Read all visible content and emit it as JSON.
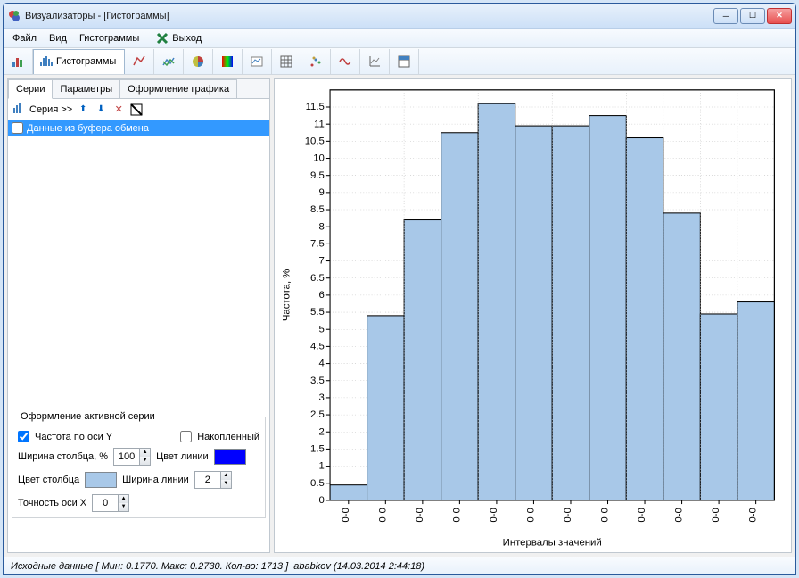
{
  "window": {
    "title": "Визуализаторы - [Гистограммы]"
  },
  "menu": {
    "file": "Файл",
    "view": "Вид",
    "histograms": "Гистограммы",
    "exit": "Выход"
  },
  "toolbar_active_label": "Гистограммы",
  "subtabs": {
    "series": "Серии",
    "params": "Параметры",
    "design": "Оформление графика"
  },
  "series_toolbar_label": "Серия >>",
  "series_item": "Данные из буфера обмена",
  "fieldset": {
    "legend": "Оформление активной серии",
    "freq_y": "Частота по оси Y",
    "accumulated": "Накопленный",
    "bar_width": "Ширина столбца, %",
    "bar_width_val": "100",
    "line_color": "Цвет линии",
    "bar_color": "Цвет столбца",
    "line_width": "Ширина линии",
    "line_width_val": "2",
    "precision_x": "Точность оси X",
    "precision_x_val": "0",
    "bar_color_val": "#a8c8e8",
    "line_color_val": "#0000ff"
  },
  "statusbar": {
    "data_label": "Исходные данные",
    "min_label": "Мин:",
    "min_val": "0.1770",
    "max_label": "Макс:",
    "max_val": "0.2730",
    "count_label": "Кол-во:",
    "count_val": "1713",
    "user": "ababkov",
    "datetime": "(14.03.2014 2:44:18)"
  },
  "chart_data": {
    "type": "bar",
    "title": "",
    "xlabel": "Интервалы значений",
    "ylabel": "Частота, %",
    "ylim": [
      0,
      12
    ],
    "yticks": [
      0,
      0.5,
      1,
      1.5,
      2,
      2.5,
      3,
      3.5,
      4,
      4.5,
      5,
      5.5,
      6,
      6.5,
      7,
      7.5,
      8,
      8.5,
      9,
      9.5,
      10,
      10.5,
      11,
      11.5
    ],
    "categories": [
      "0-0",
      "0-0",
      "0-0",
      "0-0",
      "0-0",
      "0-0",
      "0-0",
      "0-0",
      "0-0",
      "0-0",
      "0-0",
      "0-0"
    ],
    "values": [
      0.45,
      5.4,
      8.2,
      10.75,
      11.6,
      10.95,
      10.95,
      11.25,
      10.6,
      8.4,
      5.45,
      5.8
    ],
    "bar_fill": "#a8c8e8",
    "bar_stroke": "#000000"
  }
}
